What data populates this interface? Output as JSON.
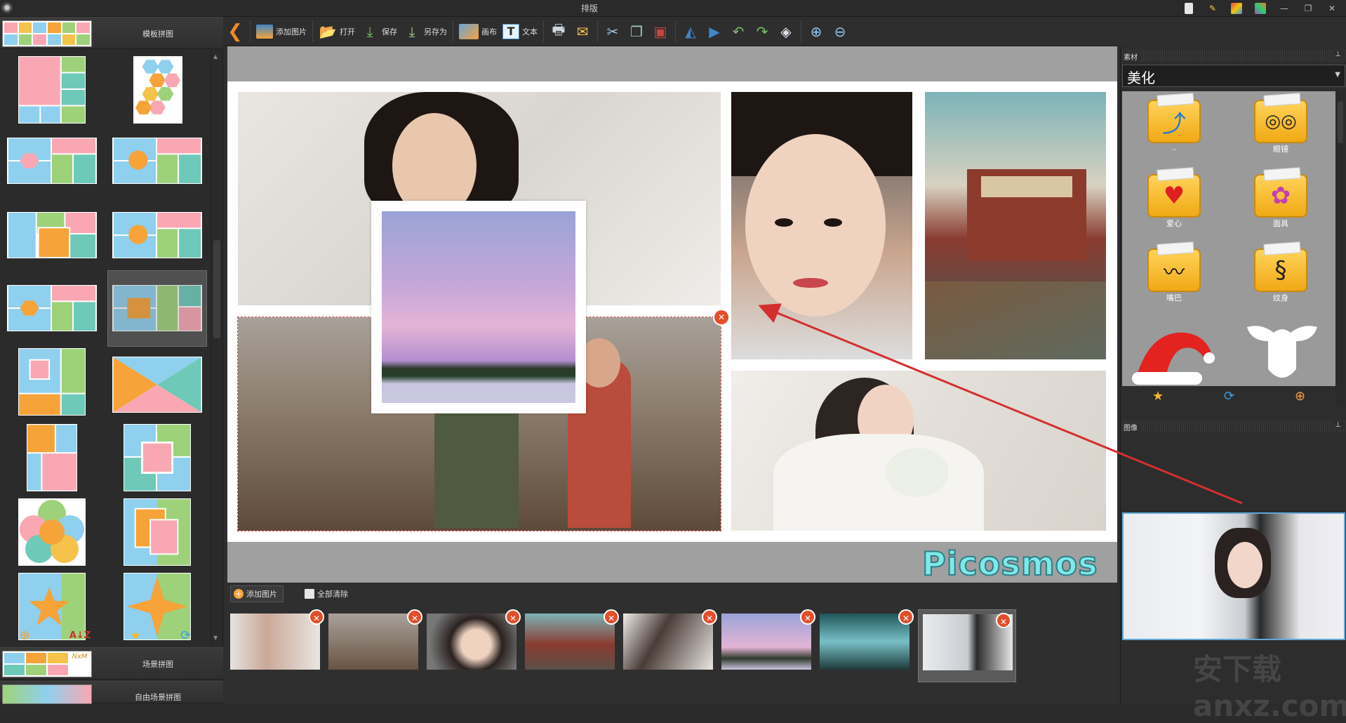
{
  "window": {
    "title": "排版"
  },
  "left_panel": {
    "template_section": "模板拼图",
    "scene_section": "场景拼图",
    "free_scene_section": "自由场景拼图",
    "scene_thumb_text": "NxM"
  },
  "toolbar": {
    "add_image": "添加图片",
    "open": "打开",
    "save": "保存",
    "save_as": "另存为",
    "canvas": "画布",
    "text": "文本"
  },
  "canvas": {
    "brand": "Picosmos"
  },
  "strip": {
    "add_image": "添加图片",
    "clear_all": "全部清除"
  },
  "right_panel": {
    "material_header": "素材",
    "category": "美化",
    "items": [
      {
        "label": ".."
      },
      {
        "label": "眼镜"
      },
      {
        "label": "爱心"
      },
      {
        "label": "面具"
      },
      {
        "label": "嘴巴"
      },
      {
        "label": "纹身"
      }
    ],
    "image_header": "图像"
  },
  "watermark": "安下载 anxz.com",
  "colors": {
    "accent": "#f6a33a",
    "close": "#e24e2b",
    "selection": "#d64848",
    "brand": "#7fe8e8"
  }
}
